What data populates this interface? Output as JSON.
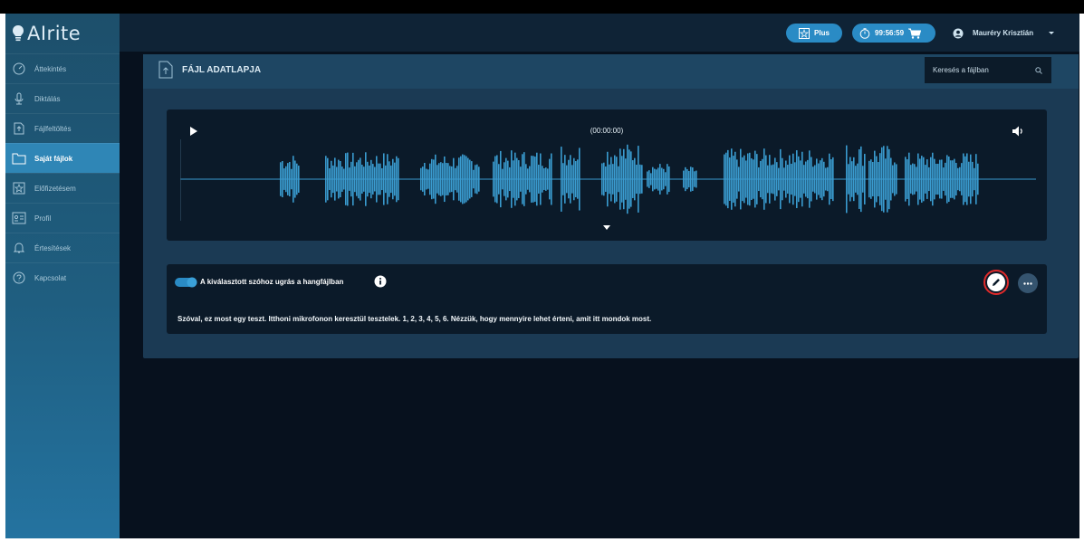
{
  "app": {
    "logo_text": "AIrite"
  },
  "sidebar": {
    "items": [
      {
        "label": "Áttekintés",
        "icon": "dashboard-icon",
        "active": false
      },
      {
        "label": "Diktálás",
        "icon": "microphone-icon",
        "active": false
      },
      {
        "label": "Fájlfeltöltés",
        "icon": "upload-icon",
        "active": false
      },
      {
        "label": "Saját fájlok",
        "icon": "folder-icon",
        "active": true
      },
      {
        "label": "Előfizetésem",
        "icon": "star-icon",
        "active": false
      },
      {
        "label": "Profil",
        "icon": "profile-card-icon",
        "active": false
      },
      {
        "label": "Értesítések",
        "icon": "bell-icon",
        "active": false
      },
      {
        "label": "Kapcsolat",
        "icon": "question-icon",
        "active": false
      }
    ]
  },
  "topbar": {
    "plan_label": "Plus",
    "timer": "99:56:59",
    "user_name": "Mauréry Krisztián"
  },
  "panel": {
    "title": "FÁJL ADATLAPJA",
    "search_placeholder": "Keresés a fájlban"
  },
  "player": {
    "time": "(00:00:00)"
  },
  "transcript": {
    "toggle_label": "A kiválasztott szóhoz ugrás a hangfájlban",
    "toggle_on": true,
    "text": "Szóval, ez most egy teszt. Itthoni mikrofonon keresztül tesztelek. 1, 2, 3, 4, 5, 6. Nézzük, hogy mennyire lehet érteni, amit itt mondok most."
  },
  "colors": {
    "accent": "#2a8bc5",
    "waveform": "#3a9bcf",
    "highlight_ring": "#e02a2a",
    "background": "#07111e"
  }
}
